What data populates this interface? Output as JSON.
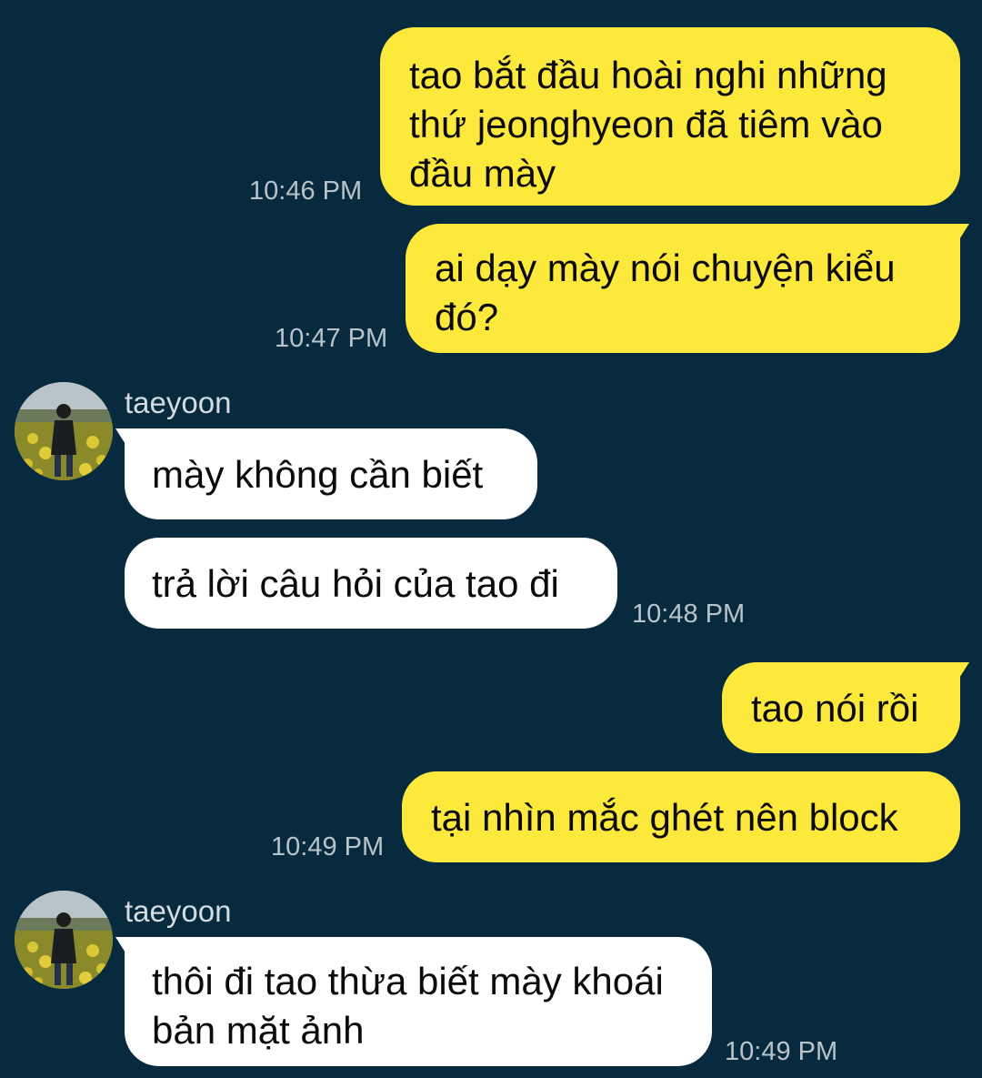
{
  "theme": {
    "background": "#072a3f",
    "outgoing_bubble": "#fde83c",
    "incoming_bubble": "#ffffff",
    "timestamp_color": "#b9c3ca"
  },
  "messages": [
    {
      "direction": "outgoing",
      "text": "tao bắt đầu hoài nghi những thứ jeonghyeon đã tiêm vào đầu mày",
      "time": "10:46 PM"
    },
    {
      "direction": "outgoing",
      "text": "ai dạy mày nói chuyện kiểu đó?",
      "time": "10:47 PM"
    },
    {
      "direction": "incoming",
      "sender": "taeyoon",
      "avatar_icon": "profile-photo-person-in-flower-field",
      "text": "mày không cần biết"
    },
    {
      "direction": "incoming",
      "text": "trả lời câu hỏi của tao đi",
      "time": "10:48 PM"
    },
    {
      "direction": "outgoing",
      "text": "tao nói rồi"
    },
    {
      "direction": "outgoing",
      "text": "tại nhìn mắc ghét nên block",
      "time": "10:49 PM"
    },
    {
      "direction": "incoming",
      "sender": "taeyoon",
      "avatar_icon": "profile-photo-person-in-flower-field",
      "text": "thôi đi tao thừa biết mày khoái bản mặt ảnh",
      "time": "10:49 PM"
    }
  ]
}
